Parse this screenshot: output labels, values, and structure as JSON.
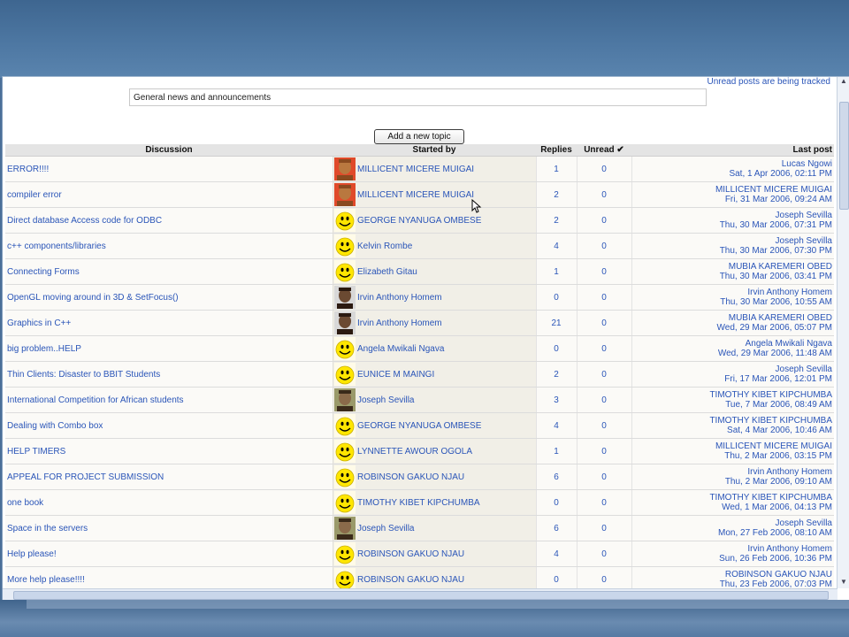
{
  "tracking_note": "Unread posts are being tracked",
  "forum_intro": "General news and announcements",
  "add_topic_label": "Add a new topic",
  "columns": {
    "discussion": "Discussion",
    "started_by": "Started by",
    "replies": "Replies",
    "unread": "Unread ✔",
    "last_post": "Last post"
  },
  "topics": [
    {
      "discussion": "ERROR!!!!",
      "avatar": "photo-child",
      "started_by": "MILLICENT MICERE MUIGAI",
      "replies": "1",
      "unread": "0",
      "last_by": "Lucas Ngowi",
      "last_date": "Sat, 1 Apr 2006, 02:11 PM"
    },
    {
      "discussion": "compiler error",
      "avatar": "photo-child",
      "started_by": "MILLICENT MICERE MUIGAI",
      "replies": "2",
      "unread": "0",
      "last_by": "MILLICENT MICERE MUIGAI",
      "last_date": "Fri, 31 Mar 2006, 09:24 AM"
    },
    {
      "discussion": "Direct database Access code for ODBC",
      "avatar": "smiley",
      "started_by": "GEORGE NYANUGA OMBESE",
      "replies": "2",
      "unread": "0",
      "last_by": "Joseph Sevilla",
      "last_date": "Thu, 30 Mar 2006, 07:31 PM"
    },
    {
      "discussion": "c++ components/libraries",
      "avatar": "smiley",
      "started_by": "Kelvin Rombe",
      "replies": "4",
      "unread": "0",
      "last_by": "Joseph Sevilla",
      "last_date": "Thu, 30 Mar 2006, 07:30 PM"
    },
    {
      "discussion": "Connecting Forms",
      "avatar": "smiley",
      "started_by": "Elizabeth Gitau",
      "replies": "1",
      "unread": "0",
      "last_by": "MUBIA KAREMERI OBED",
      "last_date": "Thu, 30 Mar 2006, 03:41 PM"
    },
    {
      "discussion": "OpenGL moving around in 3D & SetFocus()",
      "avatar": "photo-man",
      "started_by": "Irvin Anthony Homem",
      "replies": "0",
      "unread": "0",
      "last_by": "Irvin Anthony Homem",
      "last_date": "Thu, 30 Mar 2006, 10:55 AM"
    },
    {
      "discussion": "Graphics in C++",
      "avatar": "photo-man",
      "started_by": "Irvin Anthony Homem",
      "replies": "21",
      "unread": "0",
      "last_by": "MUBIA KAREMERI OBED",
      "last_date": "Wed, 29 Mar 2006, 05:07 PM"
    },
    {
      "discussion": "big problem..HELP",
      "avatar": "smiley",
      "started_by": "Angela Mwikali Ngava",
      "replies": "0",
      "unread": "0",
      "last_by": "Angela Mwikali Ngava",
      "last_date": "Wed, 29 Mar 2006, 11:48 AM"
    },
    {
      "discussion": "Thin Clients: Disaster to BBIT Students",
      "avatar": "smiley",
      "started_by": "EUNICE M MAINGI",
      "replies": "2",
      "unread": "0",
      "last_by": "Joseph Sevilla",
      "last_date": "Fri, 17 Mar 2006, 12:01 PM"
    },
    {
      "discussion": "International Competition for African students",
      "avatar": "photo-older",
      "started_by": "Joseph Sevilla",
      "replies": "3",
      "unread": "0",
      "last_by": "TIMOTHY KIBET KIPCHUMBA",
      "last_date": "Tue, 7 Mar 2006, 08:49 AM"
    },
    {
      "discussion": "Dealing with Combo box",
      "avatar": "smiley",
      "started_by": "GEORGE NYANUGA OMBESE",
      "replies": "4",
      "unread": "0",
      "last_by": "TIMOTHY KIBET KIPCHUMBA",
      "last_date": "Sat, 4 Mar 2006, 10:46 AM"
    },
    {
      "discussion": "HELP TIMERS",
      "avatar": "smiley",
      "started_by": "LYNNETTE AWOUR OGOLA",
      "replies": "1",
      "unread": "0",
      "last_by": "MILLICENT MICERE MUIGAI",
      "last_date": "Thu, 2 Mar 2006, 03:15 PM"
    },
    {
      "discussion": "APPEAL FOR PROJECT SUBMISSION",
      "avatar": "smiley",
      "started_by": "ROBINSON GAKUO NJAU",
      "replies": "6",
      "unread": "0",
      "last_by": "Irvin Anthony Homem",
      "last_date": "Thu, 2 Mar 2006, 09:10 AM"
    },
    {
      "discussion": "one book",
      "avatar": "smiley",
      "started_by": "TIMOTHY KIBET KIPCHUMBA",
      "replies": "0",
      "unread": "0",
      "last_by": "TIMOTHY KIBET KIPCHUMBA",
      "last_date": "Wed, 1 Mar 2006, 04:13 PM"
    },
    {
      "discussion": "Space in the servers",
      "avatar": "photo-older",
      "started_by": "Joseph Sevilla",
      "replies": "6",
      "unread": "0",
      "last_by": "Joseph Sevilla",
      "last_date": "Mon, 27 Feb 2006, 08:10 AM"
    },
    {
      "discussion": "Help please!",
      "avatar": "smiley",
      "started_by": "ROBINSON GAKUO NJAU",
      "replies": "4",
      "unread": "0",
      "last_by": "Irvin Anthony Homem",
      "last_date": "Sun, 26 Feb 2006, 10:36 PM"
    },
    {
      "discussion": "More help please!!!!",
      "avatar": "smiley",
      "started_by": "ROBINSON GAKUO NJAU",
      "replies": "0",
      "unread": "0",
      "last_by": "ROBINSON GAKUO NJAU",
      "last_date": "Thu, 23 Feb 2006, 07:03 PM"
    }
  ]
}
